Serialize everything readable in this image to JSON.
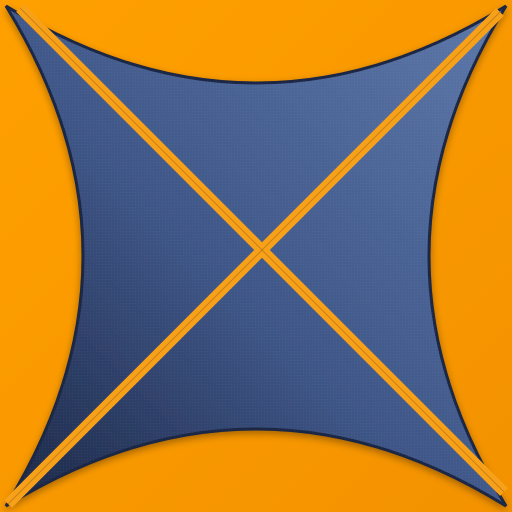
{
  "icon": {
    "name": "x-star-logo-icon",
    "colors": {
      "background": "#ffa000",
      "background_shade": "#f39200",
      "shape_light": "#5d78aa",
      "shape_mid": "#3f5788",
      "shape_dark": "#1c2746",
      "outline": "#1a2544",
      "cross_gap": "#f7a11a"
    }
  }
}
